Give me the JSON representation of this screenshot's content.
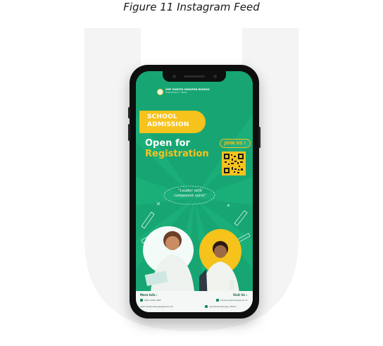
{
  "caption": "Figure 11 Instagram Feed",
  "poster": {
    "school_name": "SMP SWASTA HARAPAN BANGSA",
    "school_subtitle": "Terakreditasi A • Medan",
    "admission_line1": "SCHOOL",
    "admission_line2": "ADMISSION",
    "open_for": "Open for",
    "registration": "Registration",
    "join_us": "JOIN US !",
    "quote_line1": "\"Leader with",
    "quote_line2": "competent spirit\"",
    "footer_left_title": "More Info :",
    "footer_left_phone": "0812-3456-7890",
    "footer_left_email": "ppdb.harapanbangsa@gmail.com",
    "footer_right_title": "Visit Us :",
    "footer_right_web": "www.harapanbangsa.sch.id",
    "footer_right_social": "smpharapanbangsa_official"
  },
  "colors": {
    "poster_green": "#17a673",
    "accent_yellow": "#f6c21c",
    "phone_frame": "#0e0e0e",
    "watermark": "#f2f2f2"
  },
  "icons": [
    "camera-icon",
    "speaker-icon",
    "qr-code-icon",
    "phone-icon",
    "email-icon",
    "web-icon",
    "instagram-icon"
  ]
}
